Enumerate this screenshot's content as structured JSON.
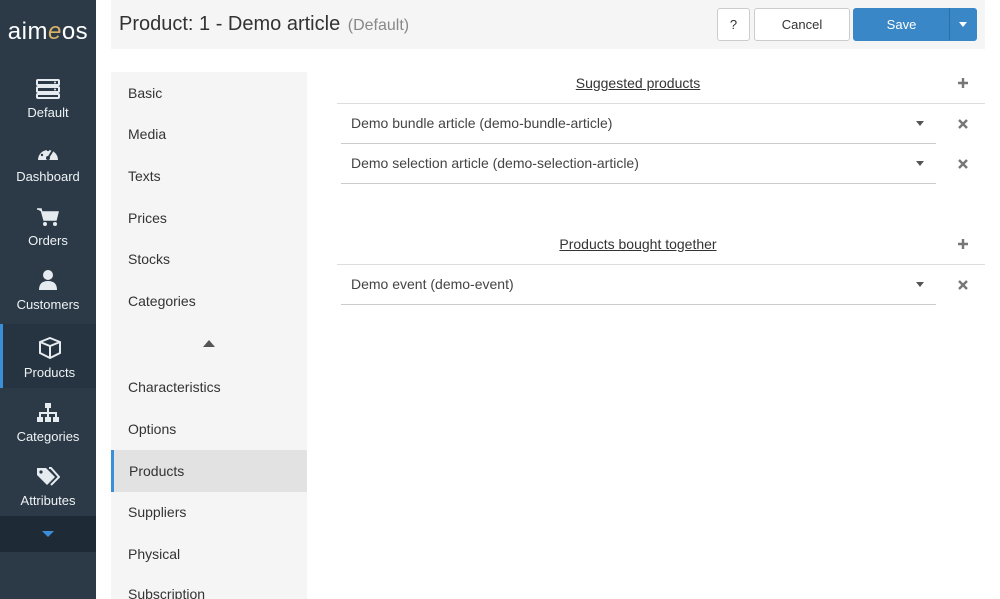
{
  "brand": {
    "logo_a": "aim",
    "logo_e": "e",
    "logo_b": "os"
  },
  "nav": {
    "items": [
      {
        "label": "Default",
        "icon": "server-icon"
      },
      {
        "label": "Dashboard",
        "icon": "dashboard-icon"
      },
      {
        "label": "Orders",
        "icon": "cart-icon"
      },
      {
        "label": "Customers",
        "icon": "user-icon"
      },
      {
        "label": "Products",
        "icon": "box-icon",
        "active": true
      },
      {
        "label": "Categories",
        "icon": "sitemap-icon"
      },
      {
        "label": "Attributes",
        "icon": "tags-icon"
      }
    ],
    "more_icon": "chevron-down-icon"
  },
  "header": {
    "title": "Product: 1 - Demo article",
    "subtitle": "(Default)",
    "help_label": "?",
    "cancel_label": "Cancel",
    "save_label": "Save"
  },
  "tabs": {
    "items": [
      {
        "label": "Basic"
      },
      {
        "label": "Media"
      },
      {
        "label": "Texts"
      },
      {
        "label": "Prices"
      },
      {
        "label": "Stocks"
      },
      {
        "label": "Categories"
      },
      {
        "label": "Characteristics"
      },
      {
        "label": "Options"
      },
      {
        "label": "Products",
        "active": true
      },
      {
        "label": "Suppliers"
      },
      {
        "label": "Physical"
      },
      {
        "label": "Subscription"
      }
    ]
  },
  "sections": [
    {
      "title": "Suggested products",
      "rows": [
        {
          "value": "Demo bundle article (demo-bundle-article)"
        },
        {
          "value": "Demo selection article (demo-selection-article)"
        }
      ]
    },
    {
      "title": "Products bought together",
      "rows": [
        {
          "value": "Demo event (demo-event)"
        }
      ]
    }
  ],
  "colors": {
    "nav_bg": "#2c3a47",
    "accent": "#3a87c8",
    "logo_accent": "#d9b36a"
  }
}
